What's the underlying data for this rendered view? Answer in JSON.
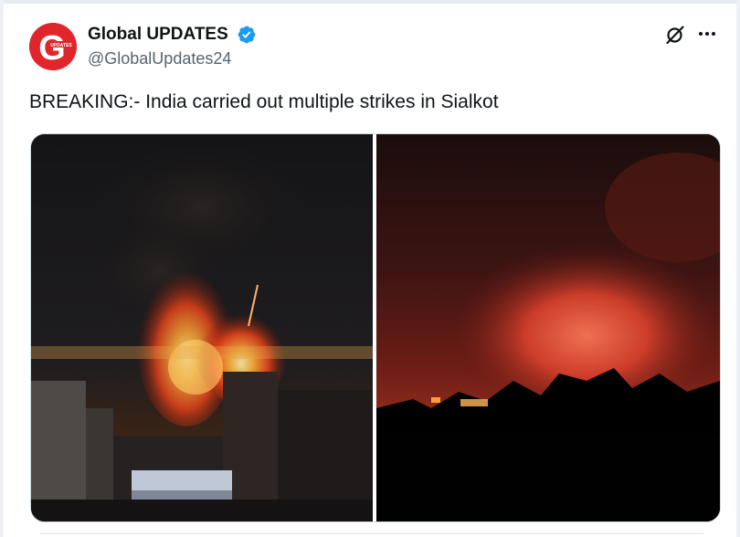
{
  "author": {
    "display_name": "Global UPDATES",
    "handle": "@GlobalUpdates24",
    "avatar_letter": "G",
    "avatar_text": "UPDATES",
    "avatar_color": "#e0262b",
    "verified": true,
    "verified_color": "#1d9bf0"
  },
  "tweet": {
    "text": "BREAKING:- India carried out multiple strikes in Sialkot"
  },
  "actions": {
    "grok_icon": "grok-icon",
    "more_icon": "more-options-icon"
  },
  "media": {
    "count": 2,
    "photos": [
      "night-explosion-city-skyline",
      "red-glow-explosion-silhouette"
    ]
  },
  "colors": {
    "text_primary": "#0f1419",
    "text_secondary": "#536471",
    "border": "#cfd9de"
  }
}
